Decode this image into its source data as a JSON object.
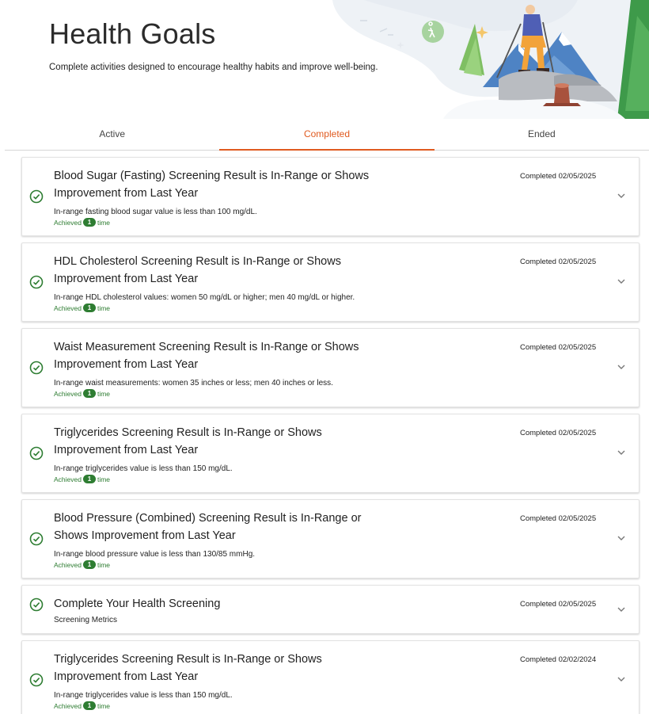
{
  "header": {
    "title": "Health Goals",
    "subtitle": "Complete activities designed to encourage healthy habits and improve well-being."
  },
  "tabs": [
    {
      "label": "Active"
    },
    {
      "label": "Completed"
    },
    {
      "label": "Ended"
    }
  ],
  "selected_tab": "Completed",
  "goals": [
    {
      "title": "Blood Sugar (Fasting) Screening Result is In-Range or Shows Improvement from Last Year",
      "description": "In-range fasting blood sugar value is less than 100 mg/dL.",
      "completed": "Completed 02/05/2025",
      "achieved_label": "Achieved",
      "achieved_count": "1",
      "achieved_suffix": "time"
    },
    {
      "title": "HDL Cholesterol Screening Result is In-Range or Shows Improvement from Last Year",
      "description": "In-range HDL cholesterol values: women 50 mg/dL or higher; men 40 mg/dL or higher.",
      "completed": "Completed 02/05/2025",
      "achieved_label": "Achieved",
      "achieved_count": "1",
      "achieved_suffix": "time"
    },
    {
      "title": "Waist Measurement Screening Result is In-Range or Shows Improvement from Last Year",
      "description": "In-range waist measurements: women 35 inches or less; men 40 inches or less.",
      "completed": "Completed 02/05/2025",
      "achieved_label": "Achieved",
      "achieved_count": "1",
      "achieved_suffix": "time"
    },
    {
      "title": "Triglycerides Screening Result is In-Range or Shows Improvement from Last Year",
      "description": "In-range triglycerides value is less than 150 mg/dL.",
      "completed": "Completed 02/05/2025",
      "achieved_label": "Achieved",
      "achieved_count": "1",
      "achieved_suffix": "time"
    },
    {
      "title": "Blood Pressure (Combined) Screening Result is In-Range or Shows Improvement from Last Year",
      "description": "In-range blood pressure value is less than 130/85 mmHg.",
      "completed": "Completed 02/05/2025",
      "achieved_label": "Achieved",
      "achieved_count": "1",
      "achieved_suffix": "time"
    },
    {
      "title": "Complete Your Health Screening",
      "description": "Screening Metrics",
      "completed": "Completed 02/05/2025"
    },
    {
      "title": "Triglycerides Screening Result is In-Range or Shows Improvement from Last Year",
      "description": "In-range triglycerides value is less than 150 mg/dL.",
      "completed": "Completed 02/02/2024",
      "achieved_label": "Achieved",
      "achieved_count": "1",
      "achieved_suffix": "time"
    }
  ],
  "icons": {
    "status": "check-circle-icon",
    "expand": "chevron-down-icon"
  },
  "colors": {
    "accent": "#e05a1f",
    "success": "#2e7d32",
    "divider": "#d6d6d6"
  }
}
